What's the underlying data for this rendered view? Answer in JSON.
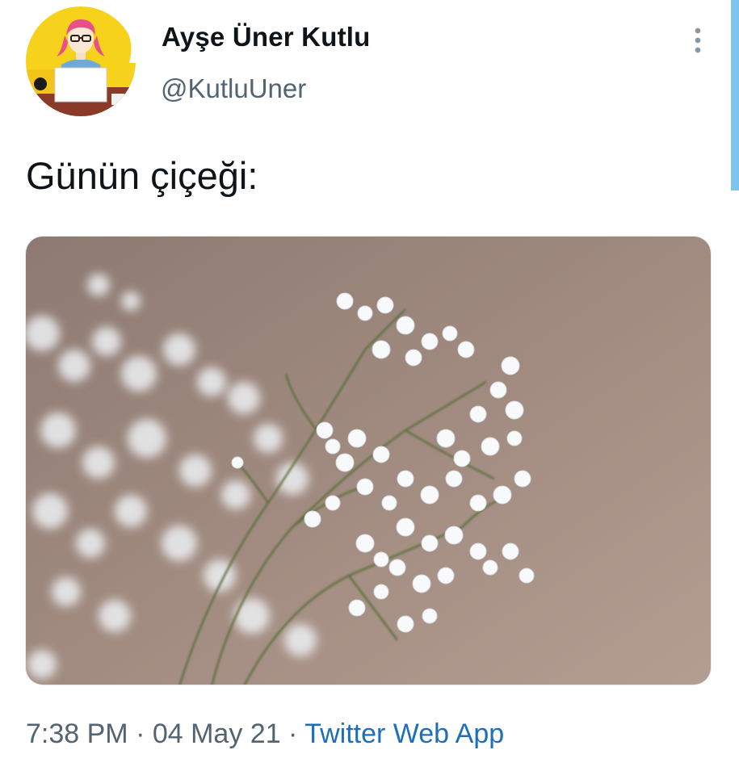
{
  "author": {
    "display_name": "Ayşe Üner Kutlu",
    "handle": "@KutluUner"
  },
  "tweet": {
    "text": "Günün çiçeği:"
  },
  "meta": {
    "time": "7:38 PM",
    "sep1": " · ",
    "date": "04 May 21",
    "sep2": " · ",
    "source": "Twitter Web App"
  },
  "icons": {
    "more": "more-vertical-icon"
  },
  "colors": {
    "link": "#1d6fb8",
    "secondary_text": "#536471",
    "photo_background": "#9e847a"
  }
}
